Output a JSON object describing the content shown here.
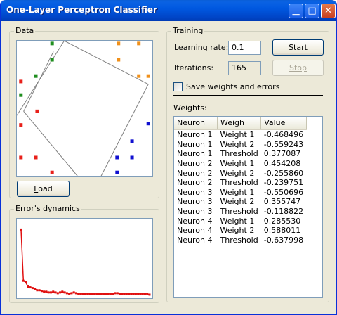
{
  "window": {
    "title": "One-Layer Perceptron Classifier"
  },
  "data_group": {
    "label": "Data",
    "load_label": "Load",
    "load_mnemonic": "L",
    "load_rest": "oad"
  },
  "errors_group": {
    "label": "Error's dynamics"
  },
  "training": {
    "label": "Training",
    "learning_rate_label": "Learning rate:",
    "learning_rate_value": "0.1",
    "iterations_label": "Iterations:",
    "iterations_value": "165",
    "start_label": "Start",
    "stop_label": "Stop",
    "save_label": "Save weights and errors",
    "save_checked": false
  },
  "weights": {
    "label": "Weights:",
    "columns": [
      "Neuron",
      "Weigh",
      "Value"
    ],
    "rows": [
      [
        "Neuron 1",
        "Weight 1",
        "-0.468496"
      ],
      [
        "Neuron 1",
        "Weight 2",
        "-0.559243"
      ],
      [
        "Neuron 1",
        "Threshold",
        "0.377087"
      ],
      [
        "Neuron 2",
        "Weight 1",
        "0.454208"
      ],
      [
        "Neuron 2",
        "Weight 2",
        "-0.255860"
      ],
      [
        "Neuron 2",
        "Threshold",
        "-0.239751"
      ],
      [
        "Neuron 3",
        "Weight 1",
        "-0.550696"
      ],
      [
        "Neuron 3",
        "Weight 2",
        "0.355747"
      ],
      [
        "Neuron 3",
        "Threshold",
        "-0.118822"
      ],
      [
        "Neuron 4",
        "Weight 1",
        "0.285530"
      ],
      [
        "Neuron 4",
        "Weight 2",
        "0.588011"
      ],
      [
        "Neuron 4",
        "Threshold",
        "-0.637998"
      ]
    ]
  },
  "colors": {
    "class_red": "#e8201a",
    "class_green": "#1f8e1f",
    "class_orange": "#f0901a",
    "class_blue": "#1010d0",
    "error_line": "#e01010"
  },
  "chart_data": [
    {
      "type": "scatter",
      "title": "",
      "xlim": [
        0,
        1
      ],
      "ylim": [
        0,
        1
      ],
      "series": [
        {
          "class": "red",
          "points": [
            [
              0.03,
              0.7
            ],
            [
              0.15,
              0.48
            ],
            [
              0.03,
              0.38
            ],
            [
              0.03,
              0.14
            ],
            [
              0.14,
              0.14
            ],
            [
              0.26,
              0.03
            ]
          ]
        },
        {
          "class": "green",
          "points": [
            [
              0.26,
              0.98
            ],
            [
              0.26,
              0.86
            ],
            [
              0.14,
              0.74
            ],
            [
              0.03,
              0.6
            ]
          ]
        },
        {
          "class": "orange",
          "points": [
            [
              0.75,
              0.98
            ],
            [
              0.9,
              0.98
            ],
            [
              0.75,
              0.86
            ],
            [
              0.9,
              0.74
            ],
            [
              0.97,
              0.74
            ]
          ]
        },
        {
          "class": "blue",
          "points": [
            [
              0.97,
              0.39
            ],
            [
              0.85,
              0.26
            ],
            [
              0.74,
              0.14
            ],
            [
              0.85,
              0.14
            ],
            [
              0.74,
              0.03
            ]
          ]
        }
      ],
      "boundaries": [
        {
          "x1": 0.35,
          "y1": 1.0,
          "x2": 0.0,
          "y2": 0.45
        },
        {
          "x1": 0.35,
          "y1": 1.0,
          "x2": 0.97,
          "y2": 0.68
        },
        {
          "x1": 0.97,
          "y1": 0.68,
          "x2": 0.62,
          "y2": 0.0
        },
        {
          "x1": 0.27,
          "y1": 0.92,
          "x2": 0.05,
          "y2": 0.48
        },
        {
          "x1": 0.05,
          "y1": 0.48,
          "x2": 0.45,
          "y2": 0.0
        }
      ]
    },
    {
      "type": "line",
      "title": "",
      "series": [
        {
          "name": "",
          "values": [
            9,
            2,
            1.8,
            1.2,
            1.1,
            1.0,
            0.9,
            0.7,
            0.7,
            0.6,
            0.5,
            0.5,
            0.4,
            0.4,
            0.5,
            0.4,
            0.3,
            0.4,
            0.5,
            0.4,
            0.3,
            0.2,
            0.3,
            0.4,
            0.3,
            0.2,
            0.2,
            0.2,
            0.2,
            0.2,
            0.2,
            0.2,
            0.2,
            0.2,
            0.2,
            0.2,
            0.2,
            0.2,
            0.2,
            0.2,
            0.2,
            0.3,
            0.3,
            0.2,
            0.2,
            0.2,
            0.2,
            0.2,
            0.2,
            0.2,
            0.2,
            0.2,
            0.2,
            0.2,
            0.2,
            0.2,
            0.1
          ]
        }
      ],
      "ylim": [
        0,
        10
      ]
    }
  ]
}
